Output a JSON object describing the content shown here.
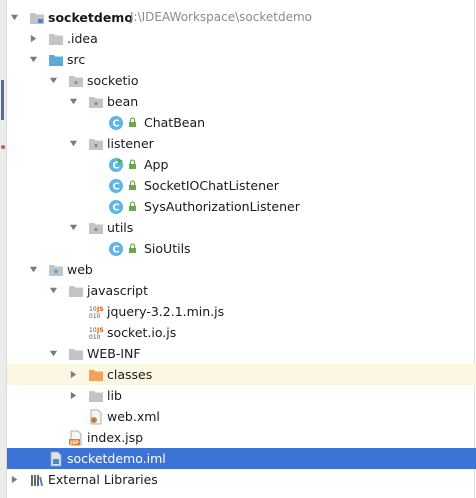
{
  "tree": {
    "project": {
      "name": "socketdemo",
      "path": "J:\\IDEAWorkspace\\socketdemo"
    },
    "idea": ".idea",
    "src": "src",
    "socketio": "socketio",
    "bean": "bean",
    "chatbean": "ChatBean",
    "listener": "listener",
    "app": "App",
    "socketiochatlistener": "SocketIOChatListener",
    "sysauthorizationlistener": "SysAuthorizationListener",
    "utils": "utils",
    "sioutils": "SioUtils",
    "web": "web",
    "javascript": "javascript",
    "jquery": "jquery-3.2.1.min.js",
    "socketio_js": "socket.io.js",
    "webinf": "WEB-INF",
    "classes": "classes",
    "lib": "lib",
    "webxml": "web.xml",
    "indexjsp": "index.jsp",
    "iml": "socketdemo.iml",
    "external": "External Libraries"
  },
  "colors": {
    "selection": "#3b73d6",
    "hover_row": "#fcf7e3",
    "folder": "#c4c4c4",
    "source_folder": "#5fa9d9",
    "classes_folder": "#f0a35e",
    "class_icon": "#5fb5e5"
  },
  "icons": {
    "arrow_expanded": "chevron-down-icon",
    "arrow_collapsed": "chevron-right-icon",
    "folder": "folder-icon",
    "class": "java-class-icon",
    "js_file": "js-file-icon",
    "xml_file": "xml-file-icon",
    "jsp_file": "jsp-file-icon",
    "iml_file": "iml-file-icon",
    "libraries": "libraries-icon"
  }
}
